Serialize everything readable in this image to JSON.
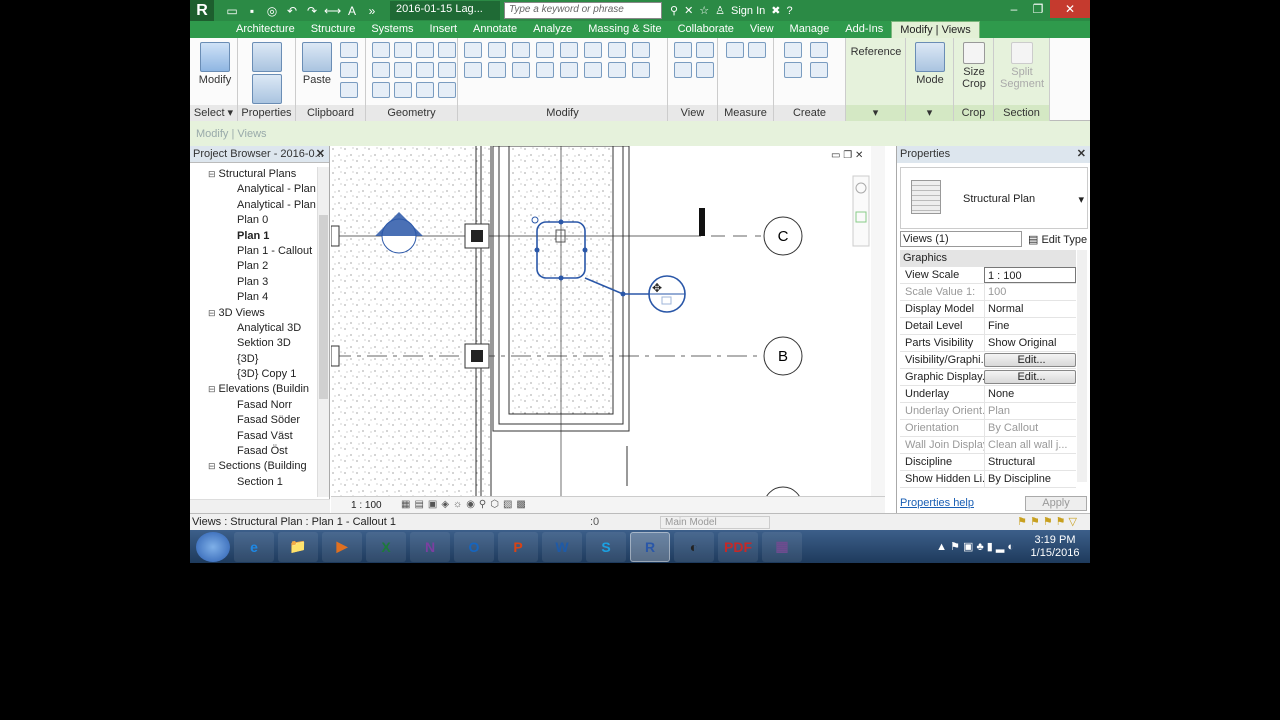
{
  "titlebar": {
    "app_logo": "R",
    "doc_title": "2016-01-15 Lag...",
    "search_placeholder": "Type a keyword or phrase",
    "signin": "Sign In"
  },
  "ribbon_tabs": [
    "Architecture",
    "Structure",
    "Systems",
    "Insert",
    "Annotate",
    "Analyze",
    "Massing & Site",
    "Collaborate",
    "View",
    "Manage",
    "Add-Ins",
    "Modify | Views"
  ],
  "active_tab": "Modify | Views",
  "ribbon": {
    "modify_label": "Modify",
    "paste_label": "Paste",
    "reference_label": "Reference",
    "mode_label": "Mode",
    "size_crop_label": "Size Crop",
    "split_segment_label": "Split Segment",
    "panels": {
      "select": "Select ▾",
      "properties": "Properties",
      "clipboard": "Clipboard",
      "geometry": "Geometry",
      "modify": "Modify",
      "view": "View",
      "measure": "Measure",
      "create": "Create",
      "crop": "Crop",
      "section": "Section"
    }
  },
  "options_bar": "Modify | Views",
  "project_browser": {
    "title": "Project Browser - 2016-0...",
    "items": [
      {
        "label": "Structural Plans",
        "level": 1
      },
      {
        "label": "Analytical - Plan",
        "level": 2
      },
      {
        "label": "Analytical - Plan",
        "level": 2
      },
      {
        "label": "Plan 0",
        "level": 2
      },
      {
        "label": "Plan 1",
        "level": 2,
        "bold": true
      },
      {
        "label": "Plan 1 - Callout",
        "level": 2
      },
      {
        "label": "Plan 2",
        "level": 2
      },
      {
        "label": "Plan 3",
        "level": 2
      },
      {
        "label": "Plan 4",
        "level": 2
      },
      {
        "label": "3D Views",
        "level": 1
      },
      {
        "label": "Analytical 3D",
        "level": 2
      },
      {
        "label": "Sektion 3D",
        "level": 2
      },
      {
        "label": "{3D}",
        "level": 2
      },
      {
        "label": "{3D} Copy 1",
        "level": 2
      },
      {
        "label": "Elevations (Buildin",
        "level": 1
      },
      {
        "label": "Fasad Norr",
        "level": 2
      },
      {
        "label": "Fasad Söder",
        "level": 2
      },
      {
        "label": "Fasad Väst",
        "level": 2
      },
      {
        "label": "Fasad Öst",
        "level": 2
      },
      {
        "label": "Sections (Building",
        "level": 1
      },
      {
        "label": "Section 1",
        "level": 2
      }
    ]
  },
  "canvas": {
    "grid_labels": [
      "C",
      "B"
    ],
    "view_scale": "1 : 100"
  },
  "properties": {
    "title": "Properties",
    "type_name": "Structural Plan",
    "instance_selector": "Views (1)",
    "edit_type": "Edit Type",
    "group": "Graphics",
    "rows": [
      {
        "name": "View Scale",
        "value": "1 : 100",
        "style": "box"
      },
      {
        "name": "Scale Value    1:",
        "value": "100",
        "style": "dim"
      },
      {
        "name": "Display Model",
        "value": "Normal"
      },
      {
        "name": "Detail Level",
        "value": "Fine"
      },
      {
        "name": "Parts Visibility",
        "value": "Show Original"
      },
      {
        "name": "Visibility/Graphi...",
        "value": "Edit...",
        "style": "btn"
      },
      {
        "name": "Graphic Display...",
        "value": "Edit...",
        "style": "btn"
      },
      {
        "name": "Underlay",
        "value": "None"
      },
      {
        "name": "Underlay Orient...",
        "value": "Plan",
        "style": "dim"
      },
      {
        "name": "Orientation",
        "value": "By Callout",
        "style": "dim"
      },
      {
        "name": "Wall Join Display",
        "value": "Clean all wall j...",
        "style": "dim"
      },
      {
        "name": "Discipline",
        "value": "Structural"
      },
      {
        "name": "Show Hidden Li...",
        "value": "By Discipline"
      }
    ],
    "help": "Properties help",
    "apply": "Apply"
  },
  "statusbar": {
    "text": "Views : Structural Plan : Plan 1 - Callout 1",
    "zero": ":0",
    "model": "Main Model"
  },
  "taskbar": {
    "apps": [
      "e",
      "📁",
      "▶",
      "X",
      "N",
      "O",
      "P",
      "W",
      "S",
      "R",
      "◐",
      "PDF",
      "▦"
    ],
    "active_app": "R",
    "time": "3:19 PM",
    "date": "1/15/2016"
  },
  "colors": {
    "title_green": "#2b8a45",
    "tab_green": "#2f9a4c",
    "contextual_green": "#e6f2dc",
    "selection_blue": "#2a57a8"
  }
}
